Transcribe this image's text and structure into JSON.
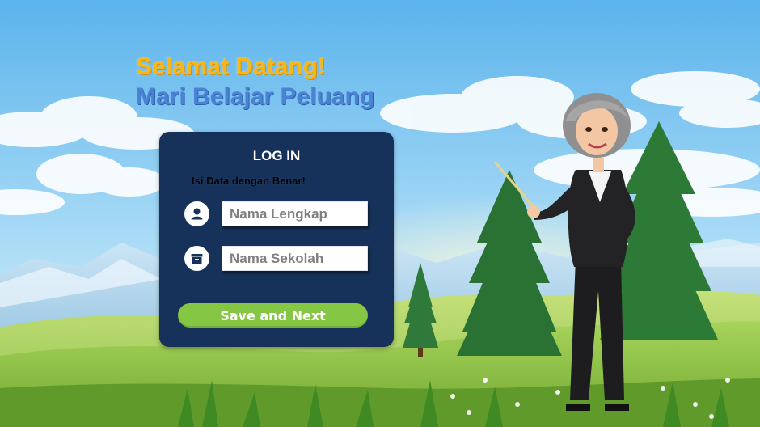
{
  "welcome": {
    "line1": "Selamat Datang!",
    "line2": "Mari Belajar Peluang"
  },
  "login": {
    "title": "LOG IN",
    "instruction": "Isi Data dengan Benar!",
    "name_placeholder": "Nama Lengkap",
    "school_placeholder": "Nama Sekolah",
    "submit_label": "Save and Next"
  },
  "icons": {
    "name_field": "user-icon",
    "school_field": "archive-box-icon"
  },
  "colors": {
    "title_yellow": "#f5b81c",
    "title_blue": "#4b82d4",
    "panel": "#17325a",
    "button": "#86c645"
  }
}
